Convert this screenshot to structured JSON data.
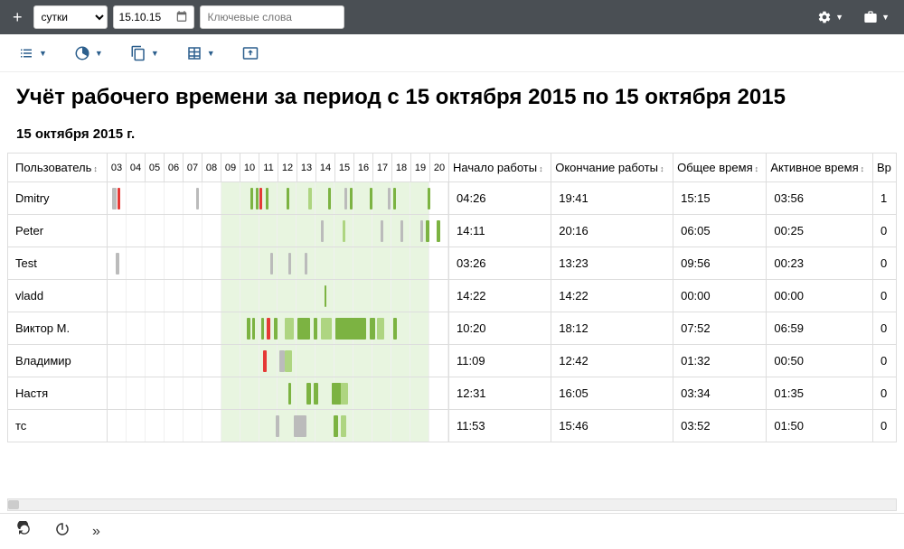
{
  "toolbar": {
    "period": "сутки",
    "date": "15.10.15",
    "search_placeholder": "Ключевые слова"
  },
  "title": "Учёт рабочего времени за период с 15 октября 2015 по 15 октября 2015",
  "subtitle": "15 октября 2015 г.",
  "columns": {
    "user": "Пользователь",
    "start": "Начало работы",
    "end": "Окончание работы",
    "total": "Общее время",
    "active": "Активное время",
    "last": "Вр"
  },
  "hours": [
    "03",
    "04",
    "05",
    "06",
    "07",
    "08",
    "09",
    "10",
    "11",
    "12",
    "13",
    "14",
    "15",
    "16",
    "17",
    "18",
    "19",
    "20"
  ],
  "rows": [
    {
      "user": "Dmitry",
      "start": "04:26",
      "end": "19:41",
      "total": "15:15",
      "active": "03:56",
      "last": "1",
      "bars": [
        {
          "c": "gray",
          "l": 5,
          "w": 5
        },
        {
          "c": "red",
          "l": 11,
          "w": 3
        },
        {
          "c": "gray",
          "l": 98,
          "w": 3
        },
        {
          "c": "green",
          "l": 158,
          "w": 3
        },
        {
          "c": "green",
          "l": 164,
          "w": 3
        },
        {
          "c": "red",
          "l": 168,
          "w": 3
        },
        {
          "c": "green",
          "l": 175,
          "w": 3
        },
        {
          "c": "green",
          "l": 198,
          "w": 3
        },
        {
          "c": "lgreen",
          "l": 222,
          "w": 4
        },
        {
          "c": "green",
          "l": 244,
          "w": 3
        },
        {
          "c": "gray",
          "l": 262,
          "w": 3
        },
        {
          "c": "green",
          "l": 268,
          "w": 3
        },
        {
          "c": "green",
          "l": 290,
          "w": 3
        },
        {
          "c": "gray",
          "l": 310,
          "w": 3
        },
        {
          "c": "green",
          "l": 316,
          "w": 3
        },
        {
          "c": "green",
          "l": 354,
          "w": 3
        }
      ]
    },
    {
      "user": "Peter",
      "start": "14:11",
      "end": "20:16",
      "total": "06:05",
      "active": "00:25",
      "last": "0",
      "bars": [
        {
          "c": "gray",
          "l": 236,
          "w": 3
        },
        {
          "c": "lgreen",
          "l": 260,
          "w": 3
        },
        {
          "c": "gray",
          "l": 302,
          "w": 3
        },
        {
          "c": "gray",
          "l": 324,
          "w": 3
        },
        {
          "c": "gray",
          "l": 346,
          "w": 3
        },
        {
          "c": "green",
          "l": 352,
          "w": 4
        },
        {
          "c": "green",
          "l": 364,
          "w": 4
        }
      ]
    },
    {
      "user": "Test",
      "start": "03:26",
      "end": "13:23",
      "total": "09:56",
      "active": "00:23",
      "last": "0",
      "bars": [
        {
          "c": "gray",
          "l": 9,
          "w": 4
        },
        {
          "c": "gray",
          "l": 180,
          "w": 3
        },
        {
          "c": "gray",
          "l": 200,
          "w": 3
        },
        {
          "c": "gray",
          "l": 218,
          "w": 3
        }
      ]
    },
    {
      "user": "vladd",
      "start": "14:22",
      "end": "14:22",
      "total": "00:00",
      "active": "00:00",
      "last": "0",
      "bars": [
        {
          "c": "green",
          "l": 240,
          "w": 2
        }
      ]
    },
    {
      "user": "Виктор М.",
      "start": "10:20",
      "end": "18:12",
      "total": "07:52",
      "active": "06:59",
      "last": "0",
      "bars": [
        {
          "c": "green",
          "l": 154,
          "w": 4
        },
        {
          "c": "green",
          "l": 160,
          "w": 3
        },
        {
          "c": "green",
          "l": 170,
          "w": 3
        },
        {
          "c": "red",
          "l": 176,
          "w": 4
        },
        {
          "c": "green",
          "l": 184,
          "w": 4
        },
        {
          "c": "lgreen",
          "l": 196,
          "w": 10
        },
        {
          "c": "green",
          "l": 210,
          "w": 14
        },
        {
          "c": "green",
          "l": 228,
          "w": 4
        },
        {
          "c": "lgreen",
          "l": 236,
          "w": 12
        },
        {
          "c": "green",
          "l": 252,
          "w": 34
        },
        {
          "c": "green",
          "l": 290,
          "w": 6
        },
        {
          "c": "lgreen",
          "l": 298,
          "w": 8
        },
        {
          "c": "green",
          "l": 316,
          "w": 4
        }
      ]
    },
    {
      "user": "Владимир",
      "start": "11:09",
      "end": "12:42",
      "total": "01:32",
      "active": "00:50",
      "last": "0",
      "bars": [
        {
          "c": "red",
          "l": 172,
          "w": 4
        },
        {
          "c": "gray",
          "l": 190,
          "w": 6
        },
        {
          "c": "lgreen",
          "l": 196,
          "w": 8
        }
      ]
    },
    {
      "user": "Настя",
      "start": "12:31",
      "end": "16:05",
      "total": "03:34",
      "active": "01:35",
      "last": "0",
      "bars": [
        {
          "c": "green",
          "l": 200,
          "w": 3
        },
        {
          "c": "green",
          "l": 220,
          "w": 5
        },
        {
          "c": "green",
          "l": 228,
          "w": 5
        },
        {
          "c": "lgreen",
          "l": 248,
          "w": 18
        },
        {
          "c": "green",
          "l": 248,
          "w": 10
        }
      ]
    },
    {
      "user": "тс",
      "start": "11:53",
      "end": "15:46",
      "total": "03:52",
      "active": "01:50",
      "last": "0",
      "bars": [
        {
          "c": "gray",
          "l": 186,
          "w": 4
        },
        {
          "c": "gray",
          "l": 206,
          "w": 14
        },
        {
          "c": "green",
          "l": 250,
          "w": 5
        },
        {
          "c": "lgreen",
          "l": 258,
          "w": 6
        }
      ]
    }
  ]
}
